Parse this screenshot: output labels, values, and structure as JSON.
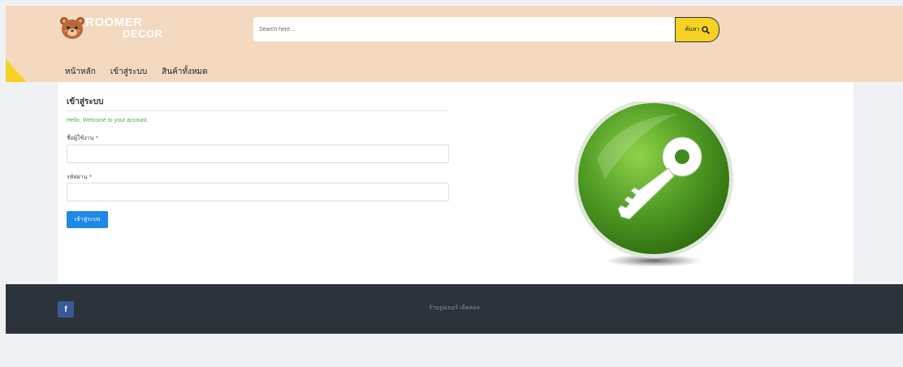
{
  "brand": {
    "line1": "ROOMER",
    "line2": "DECOR"
  },
  "search": {
    "placeholder": "Search here...",
    "button_label": "ค้นหา"
  },
  "nav": {
    "items": [
      {
        "label": "หน้าหลัก"
      },
      {
        "label": "เข้าสู่ระบบ"
      },
      {
        "label": "สินค้าทั้งหมด"
      }
    ]
  },
  "login": {
    "title": "เข้าสู่ระบบ",
    "welcome": "Hello, Welcome to your account.",
    "username_label": "ชื่อผู้ใช้งาน",
    "password_label": "รหัสผ่าน",
    "required_mark": "*",
    "username_value": "",
    "password_value": "",
    "submit_label": "เข้าสู่ระบบ"
  },
  "footer": {
    "social_icon": "f",
    "text": "ร้านรูมเมอร์ เด็คคอล"
  },
  "colors": {
    "header_bg": "#f3d9bf",
    "accent_yellow": "#f7d224",
    "primary_blue": "#1e88e5",
    "footer_bg": "#2d333a",
    "success_green": "#4caf50"
  },
  "icons": {
    "search": "search-icon",
    "key": "key-icon",
    "facebook": "facebook-icon",
    "bear": "bear-logo-icon"
  }
}
